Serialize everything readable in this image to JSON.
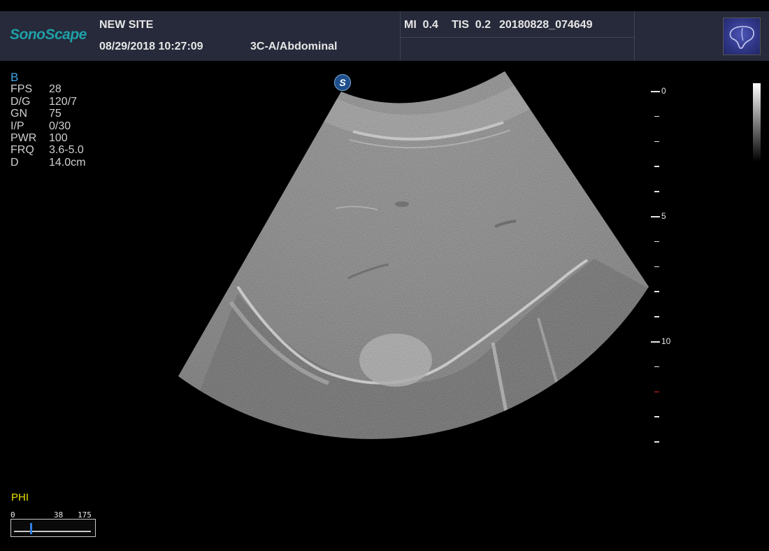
{
  "header": {
    "brand": "SonoScape",
    "site": "NEW SITE",
    "datetime": "08/29/2018 10:27:09",
    "probe_preset": "3C-A/Abdominal",
    "mi": "MI  0.4",
    "tis": "TIS  0.2",
    "study_id": "20180828_074649",
    "exam_icon": "liver-icon"
  },
  "params": {
    "mode": "B",
    "rows": [
      {
        "key": "FPS",
        "value": "28"
      },
      {
        "key": "D/G",
        "value": "120/7"
      },
      {
        "key": "GN",
        "value": "75"
      },
      {
        "key": "I/P",
        "value": "0/30"
      },
      {
        "key": "PWR",
        "value": "100"
      },
      {
        "key": "FRQ",
        "value": "3.6-5.0"
      },
      {
        "key": "D",
        "value": "14.0cm"
      }
    ]
  },
  "scale": {
    "labels": [
      "0",
      "5",
      "10"
    ]
  },
  "phi": {
    "label": "PHI",
    "min": "0",
    "current": "38",
    "max": "175",
    "level": 38
  },
  "badge": "S",
  "colors": {
    "header_bg": "#262a3a",
    "brand": "#1fa0a8",
    "mode": "#3fa6e6",
    "phi": "#e8e000",
    "focus_marker": "#e02020"
  }
}
